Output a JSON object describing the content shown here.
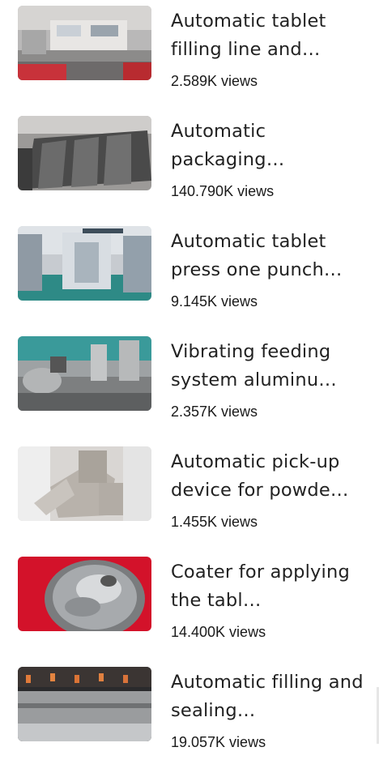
{
  "videos": [
    {
      "title": "Automatic tablet filling line and…",
      "views": "2.589K views"
    },
    {
      "title": "Automatic packaging…",
      "views": "140.790K views"
    },
    {
      "title": "Automatic tablet press one punch…",
      "views": "9.145K views"
    },
    {
      "title": "Vibrating feeding system aluminu…",
      "views": "2.357K views"
    },
    {
      "title": "Automatic pick-up device for powde…",
      "views": "1.455K views"
    },
    {
      "title": "Coater for applying the tabl…",
      "views": "14.400K views"
    },
    {
      "title": "Automatic filling and sealing…",
      "views": "19.057K views"
    }
  ]
}
